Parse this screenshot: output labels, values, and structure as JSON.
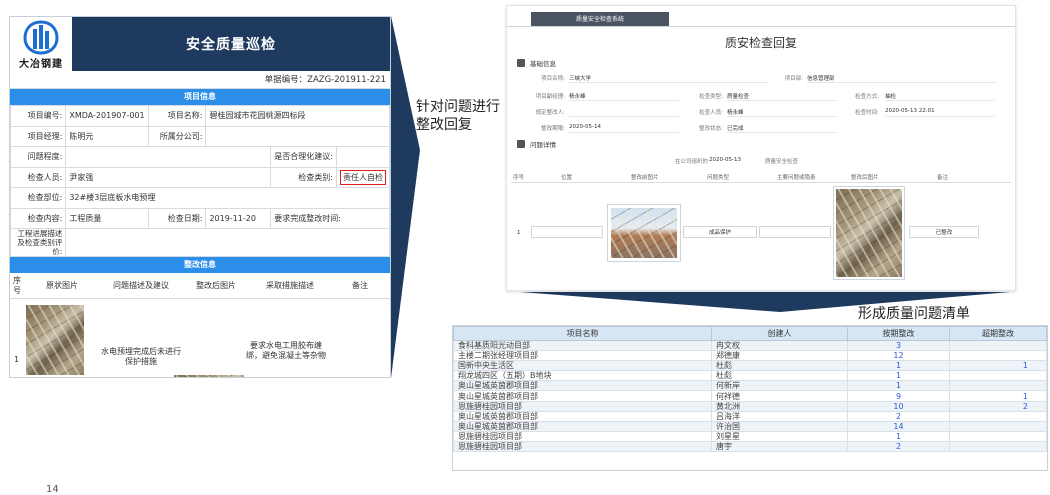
{
  "left_form": {
    "logo_text": "大冶钢建",
    "title": "安全质量巡检",
    "doc_no": "单据编号：ZAZG-201911-221",
    "section_project": "项目信息",
    "labels": {
      "project_no": "项目编号:",
      "project_name": "项目名称:",
      "project_manager": "项目经理:",
      "branch": "所属分公司:",
      "severity": "问题程度:",
      "reasonable": "是否合理化建议:",
      "inspector": "检查人员:",
      "category": "检查类别:",
      "location": "检查部位:",
      "content": "检查内容:",
      "date": "检查日期:",
      "deadline": "要求完成整改时间:",
      "progress_desc": "工程进展描述及检查类别评价:"
    },
    "values": {
      "project_no": "XMDA-201907-001",
      "project_name": "碧桂园城市花园桃源四标段",
      "project_manager": "陈明元",
      "inspector": "尹家强",
      "category": "责任人自检",
      "location": "32#楼3层底板水电预埋",
      "content": "工程质量",
      "date": "2019-11-20"
    },
    "section_rectify": "整改信息",
    "columns": [
      "序号",
      "原状图片",
      "问题描述及建议",
      "整改后图片",
      "采取措施描述",
      "备注"
    ],
    "row": {
      "no": "1",
      "desc": "水电预埋完成后未进行保护措施",
      "measure": "要求水电工用胶布缠绑，避免混凝土等杂物"
    }
  },
  "callouts": {
    "rectify": "针对问题进行整改回复",
    "list": "形成质量问题清单"
  },
  "system": {
    "tab": "质量安全检查系统",
    "title": "质安检查回复",
    "basic_section": "基础信息",
    "fields": [
      {
        "label": "项目名称:",
        "value": "三峡大学"
      },
      {
        "label": "项目部:",
        "value": "信息管理部"
      },
      {
        "label": "项目副经理:",
        "value": "杨永峰"
      },
      {
        "label": "检查类型:",
        "value": "质量检查"
      },
      {
        "label": "检查方式:",
        "value": "抽检"
      },
      {
        "label": "规定整改人:",
        "value": ""
      },
      {
        "label": "检查人员:",
        "value": "杨永峰"
      },
      {
        "label": "检查时间:",
        "value": "2020-05-13 22:01"
      },
      {
        "label": "整改期限:",
        "value": "2020-05-14"
      },
      {
        "label": "整改状态:",
        "value": "已完成"
      }
    ],
    "issue_section": "问题详情",
    "summary": {
      "org_label": "在公司组织的",
      "date": "2020-05-13",
      "type": "质量安全检查"
    },
    "columns": [
      "序号",
      "位置",
      "整改前图片",
      "问题类型",
      "主要问题或隐患",
      "整改后图片",
      "备注"
    ],
    "row": {
      "no": "1",
      "issue_type": "成品保护",
      "status": "已整改"
    }
  },
  "issue_list": {
    "columns": [
      "项目名称",
      "创建人",
      "按期整改",
      "超期整改"
    ],
    "rows": [
      {
        "name": "食科基质阳光动目部",
        "creator": "冉文权",
        "ontime": "3",
        "overdue": ""
      },
      {
        "name": "主楼二期张经理项目部",
        "creator": "郑德康",
        "ontime": "12",
        "overdue": ""
      },
      {
        "name": "国新中央生活区",
        "creator": "杜彪",
        "ontime": "1",
        "overdue": "1"
      },
      {
        "name": "翔龙城四区（五期）B地块",
        "creator": "杜彪",
        "ontime": "1",
        "overdue": ""
      },
      {
        "name": "奥山星城英茵郡项目部",
        "creator": "何新岸",
        "ontime": "1",
        "overdue": ""
      },
      {
        "name": "奥山星城英茵郡项目部",
        "creator": "何祥德",
        "ontime": "9",
        "overdue": "1"
      },
      {
        "name": "恩施碧桂园项目部",
        "creator": "黄北洲",
        "ontime": "10",
        "overdue": "2"
      },
      {
        "name": "奥山星城英茵郡项目部",
        "creator": "吕海洋",
        "ontime": "2",
        "overdue": ""
      },
      {
        "name": "奥山星城英茵郡项目部",
        "creator": "许治国",
        "ontime": "14",
        "overdue": ""
      },
      {
        "name": "恩施碧桂园项目部",
        "creator": "刘星星",
        "ontime": "1",
        "overdue": ""
      },
      {
        "name": "恩施碧桂园项目部",
        "creator": "唐宇",
        "ontime": "2",
        "overdue": ""
      }
    ]
  },
  "page_number": "14",
  "colors": {
    "navy": "#1f3a5f",
    "blue": "#2b8ee8",
    "highlight": "#e02020",
    "arrow": "#1f3a5f"
  }
}
